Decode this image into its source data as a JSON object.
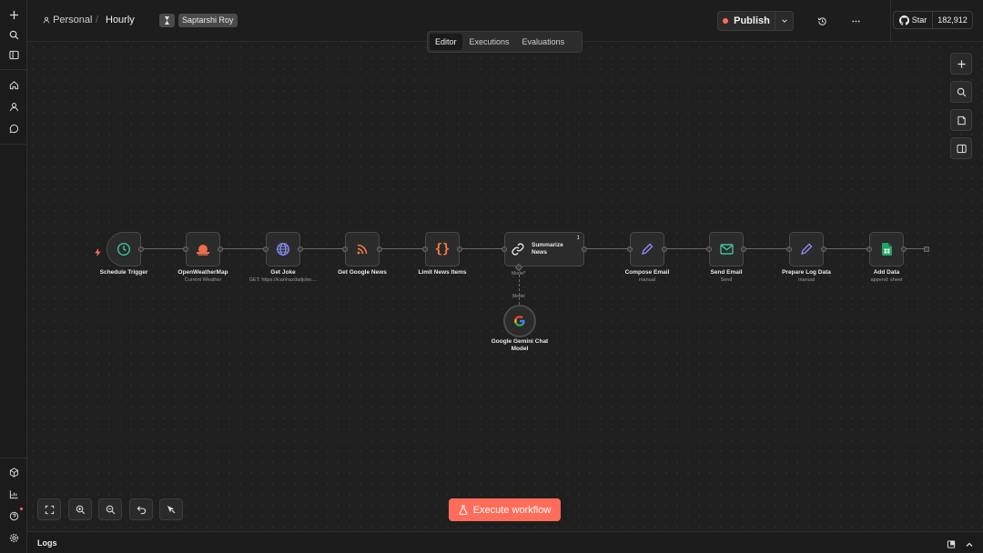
{
  "header": {
    "workspace": "Personal",
    "separator": "/",
    "workflow_name": "Hourly",
    "owner_tag": "Saptarshi Roy",
    "publish_label": "Publish",
    "github_star_label": "Star",
    "github_star_count": "182,912"
  },
  "tabs": [
    {
      "label": "Editor",
      "active": true
    },
    {
      "label": "Executions",
      "active": false
    },
    {
      "label": "Evaluations",
      "active": false
    }
  ],
  "nodes": [
    {
      "label": "Schedule Trigger",
      "sub": "",
      "icon": "clock-icon"
    },
    {
      "label": "OpenWeatherMap",
      "sub": "Current Weather",
      "icon": "weather-icon"
    },
    {
      "label": "Get Joke",
      "sub": "GET: https://icanhazdadjoke....",
      "icon": "globe-icon"
    },
    {
      "label": "Get Google News",
      "sub": "",
      "icon": "rss-icon"
    },
    {
      "label": "Limit News Items",
      "sub": "",
      "icon": "braces-icon"
    },
    {
      "label": "Summarize News",
      "sub": "",
      "icon": "link-icon",
      "badge": "1"
    },
    {
      "label": "Compose Email",
      "sub": "manual",
      "icon": "pencil-icon"
    },
    {
      "label": "Send Email",
      "sub": "Send",
      "icon": "mail-icon"
    },
    {
      "label": "Prepare Log Data",
      "sub": "manual",
      "icon": "pencil-icon"
    },
    {
      "label": "Add Data",
      "sub": "append: sheet",
      "icon": "sheets-icon"
    }
  ],
  "model_port_label": "Model",
  "model_port_required": "*",
  "model_connector_label": "Model",
  "model_node": {
    "label_line1": "Google Gemini Chat",
    "label_line2": "Model",
    "icon": "google-icon"
  },
  "execute_label": "Execute workflow",
  "logs_label": "Logs",
  "colors": {
    "accent": "#ff6d5a",
    "clock": "#3fc1a0",
    "globe": "#8a8cf5",
    "rss": "#ff7a3d",
    "braces": "#ff7a3d",
    "pencil": "#8a8cf5",
    "mail": "#3fc1a0",
    "sheets": "#21a366"
  }
}
